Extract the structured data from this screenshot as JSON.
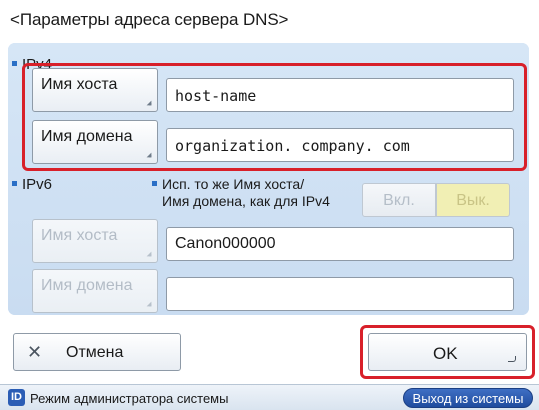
{
  "dialog": {
    "title": "<Параметры адреса сервера DNS>"
  },
  "ipv4": {
    "section_label": "IPv4",
    "host_button": "Имя хоста",
    "host_value": "host-name",
    "domain_button": "Имя домена",
    "domain_value": "organization. company. com"
  },
  "ipv6": {
    "section_label": "IPv6",
    "same_note_line1": "Исп. то же Имя хоста/",
    "same_note_line2": "Имя домена, как для IPv4",
    "toggle_on": "Вкл.",
    "toggle_off": "Вык.",
    "host_button": "Имя хоста",
    "host_value": "Canon000000",
    "domain_button": "Имя домена",
    "domain_value": ""
  },
  "footer": {
    "cancel_label": "Отмена",
    "ok_label": "OK"
  },
  "status_bar": {
    "id_icon_text": "ID",
    "admin_mode": "Режим администратора системы",
    "logout_label": "Выход из системы"
  },
  "colors": {
    "panel_bg": "#cfe1f4",
    "highlight": "#d8202a",
    "toggle_off_bg": "#f1efb4",
    "logout_bg": "#2b5db5"
  }
}
